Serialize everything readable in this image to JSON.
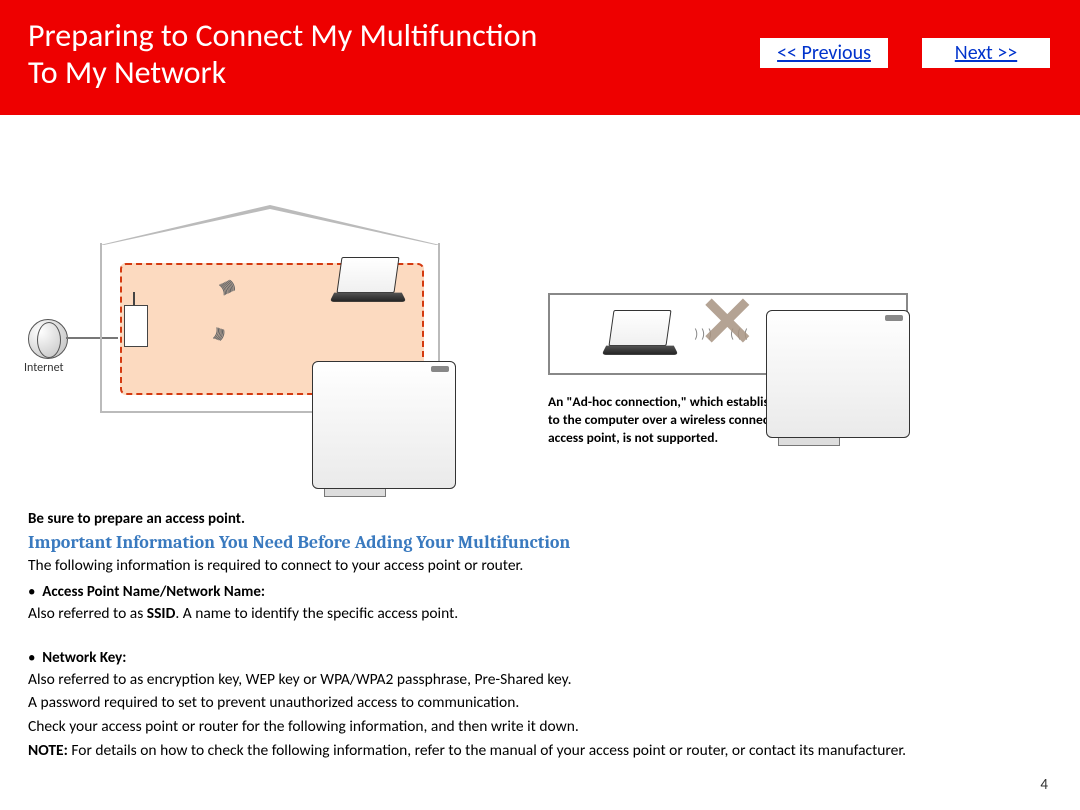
{
  "header": {
    "title_line1": "Preparing to Connect My Multifunction",
    "title_line2": "To My Network",
    "prev": "<< Previous",
    "next": "Next >>"
  },
  "illustration": {
    "internet_label": "Internet"
  },
  "adhoc_note": "An \"Ad-hoc connection,\" which establishes a direct connection to the computer over a wireless connection without using an access point, is not supported.",
  "prepare_point": "Be sure to prepare an access point.",
  "subheading": "Important Information You Need Before Adding Your Multifunction",
  "intro": "The following information is required to connect to your access point or router.",
  "bullet1_label": "Access Point Name/Network Name:",
  "bullet1_text_a": "Also referred to as ",
  "bullet1_ssid": "SSID",
  "bullet1_text_b": ". A name to identify the specific access point.",
  "bullet2_label": "Network Key:",
  "bullet2_line1": "Also referred to as encryption key, WEP key or WPA/WPA2 passphrase, Pre-Shared key.",
  "bullet2_line2": "A password required to set to prevent unauthorized access to communication.",
  "bullet2_line3": "Check your access point or router for the following information, and then write it down.",
  "note_label": "NOTE:",
  "note_text": "  For details on how to check the following information, refer to the manual of your access point or router, or contact its manufacturer.",
  "page_number": "4"
}
